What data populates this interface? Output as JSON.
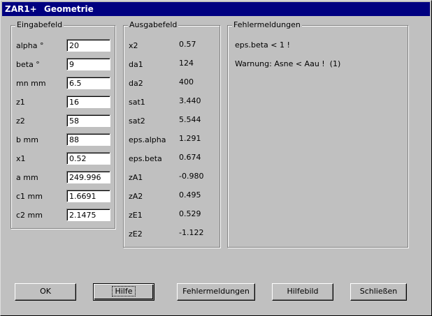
{
  "window": {
    "app": "ZAR1+",
    "title": "Geometrie"
  },
  "input": {
    "legend": "Eingabefeld",
    "fields": [
      {
        "label": "alpha °",
        "value": "20"
      },
      {
        "label": "beta  °",
        "value": "9"
      },
      {
        "label": "mn   mm",
        "value": "6.5"
      },
      {
        "label": "z1",
        "value": "16"
      },
      {
        "label": "z2",
        "value": "58"
      },
      {
        "label": "b    mm",
        "value": "88"
      },
      {
        "label": "x1",
        "value": "0.52"
      },
      {
        "label": "a    mm",
        "value": "249.996"
      },
      {
        "label": "c1   mm",
        "value": "1.6691"
      },
      {
        "label": "c2   mm",
        "value": "2.1475"
      }
    ]
  },
  "output": {
    "legend": "Ausgabefeld",
    "rows": [
      {
        "label": "x2",
        "value": "0.57"
      },
      {
        "label": "da1",
        "value": "124"
      },
      {
        "label": "da2",
        "value": "400"
      },
      {
        "label": "sat1",
        "value": "3.440"
      },
      {
        "label": "sat2",
        "value": "5.544"
      },
      {
        "label": "eps.alpha",
        "value": "1.291"
      },
      {
        "label": "eps.beta",
        "value": "0.674"
      },
      {
        "label": "zA1",
        "value": "-0.980"
      },
      {
        "label": "zA2",
        "value": "0.495"
      },
      {
        "label": "zE1",
        "value": "0.529"
      },
      {
        "label": "zE2",
        "value": "-1.122"
      }
    ]
  },
  "errors": {
    "legend": "Fehlermeldungen",
    "messages": [
      "eps.beta < 1 !",
      "Warnung: Asne < Aau !  (1)"
    ]
  },
  "buttons": {
    "ok": "OK",
    "hilfe": "Hilfe",
    "fehlermeldungen": "Fehlermeldungen",
    "hilfebild": "Hilfebild",
    "schliessen": "Schließen"
  }
}
